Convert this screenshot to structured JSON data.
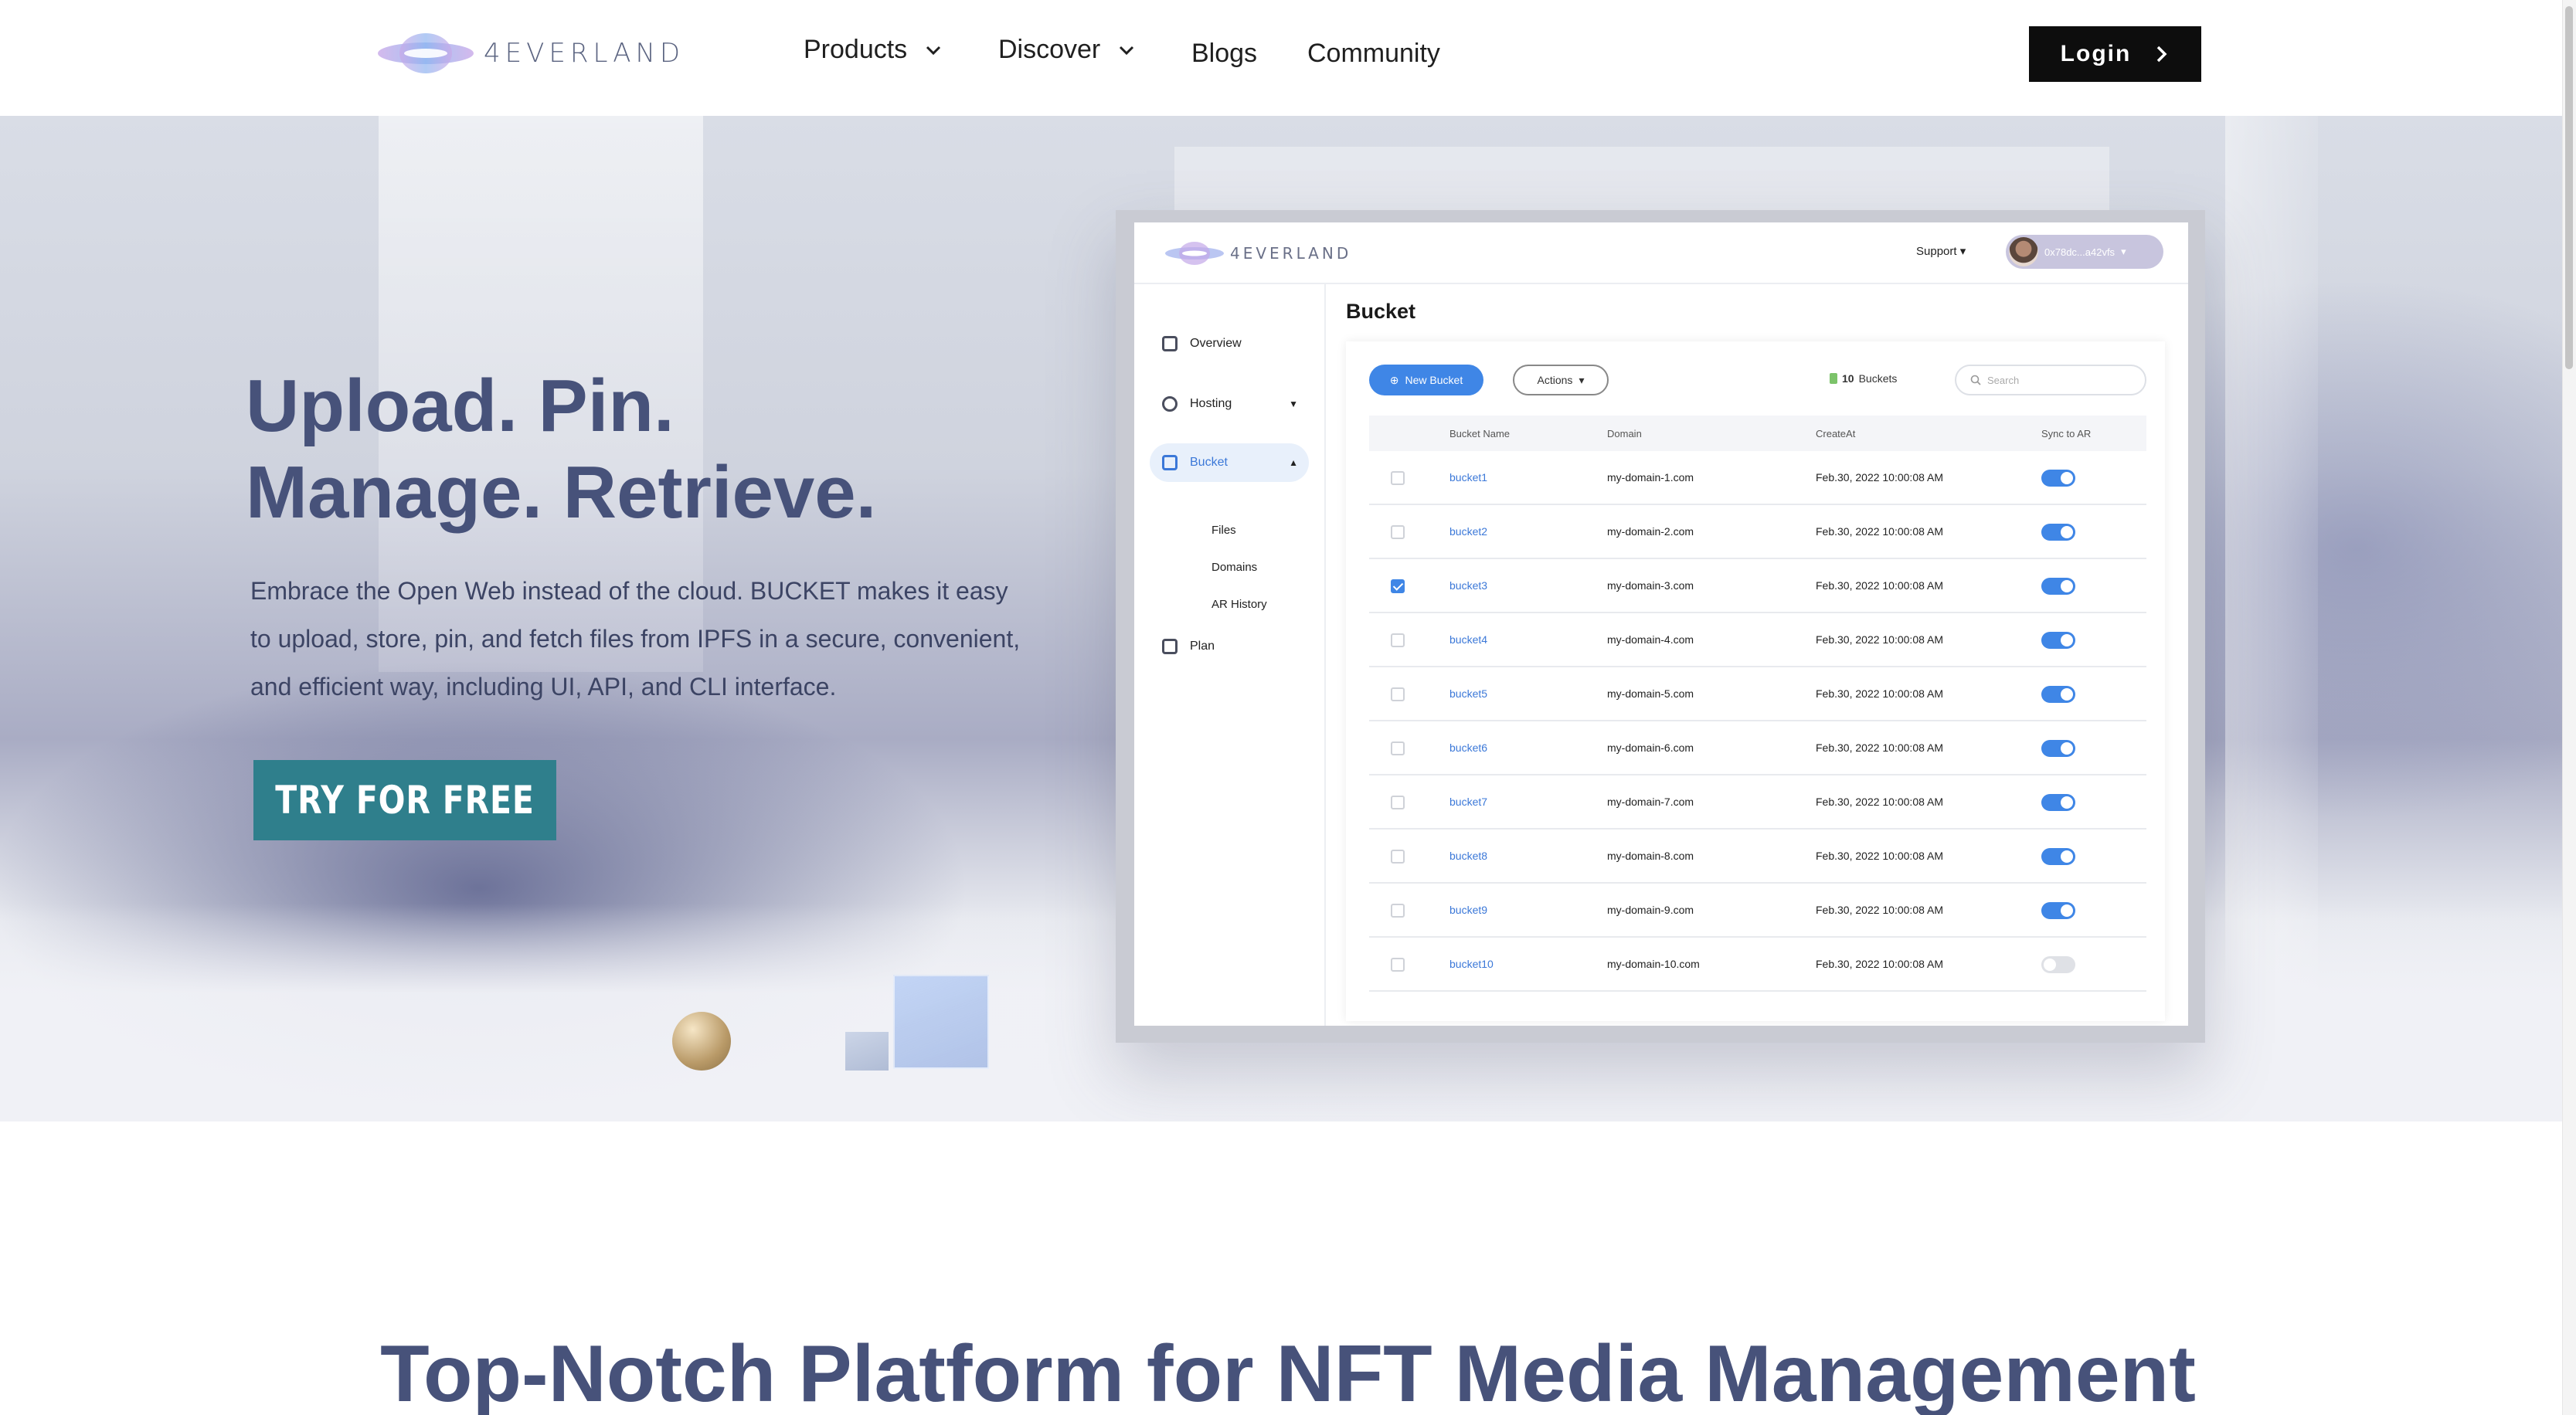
{
  "nav": {
    "logo_text": "4EVERLAND",
    "items": [
      {
        "label": "Products",
        "has_dropdown": true
      },
      {
        "label": "Discover",
        "has_dropdown": true
      },
      {
        "label": "Blogs",
        "has_dropdown": false
      },
      {
        "label": "Community",
        "has_dropdown": false
      }
    ],
    "login_label": "Login"
  },
  "hero": {
    "headline_line1": "Upload. Pin.",
    "headline_line2": "Manage. Retrieve.",
    "description": "Embrace the Open Web instead of the cloud. BUCKET makes it easy to upload, store, pin, and fetch files from IPFS in a secure, convenient, and efficient way, including UI, API, and CLI interface.",
    "cta_label": "TRY FOR FREE"
  },
  "dashboard": {
    "logo_text": "4EVERLAND",
    "support_label": "Support",
    "user_label": "0x78dc...a42vfs",
    "sidebar": {
      "items": [
        {
          "label": "Overview",
          "icon": "monitor-icon"
        },
        {
          "label": "Hosting",
          "icon": "globe-icon"
        },
        {
          "label": "Bucket",
          "icon": "box-icon",
          "active": true
        },
        {
          "label": "Plan",
          "icon": "receipt-icon"
        }
      ],
      "sub_items": [
        "Files",
        "Domains",
        "AR History"
      ]
    },
    "page_title": "Bucket",
    "new_bucket_label": "New Bucket",
    "actions_label": "Actions",
    "bucket_count": "10",
    "bucket_count_suffix": "Buckets",
    "search_placeholder": "Search",
    "table": {
      "headers": [
        "Bucket Name",
        "Domain",
        "CreateAt",
        "Sync to AR"
      ],
      "rows": [
        {
          "name": "bucket1",
          "domain": "my-domain-1.com",
          "created": "Feb.30, 2022 10:00:08 AM",
          "checked": false,
          "sync": true
        },
        {
          "name": "bucket2",
          "domain": "my-domain-2.com",
          "created": "Feb.30, 2022 10:00:08 AM",
          "checked": false,
          "sync": true
        },
        {
          "name": "bucket3",
          "domain": "my-domain-3.com",
          "created": "Feb.30, 2022 10:00:08 AM",
          "checked": true,
          "sync": true
        },
        {
          "name": "bucket4",
          "domain": "my-domain-4.com",
          "created": "Feb.30, 2022 10:00:08 AM",
          "checked": false,
          "sync": true
        },
        {
          "name": "bucket5",
          "domain": "my-domain-5.com",
          "created": "Feb.30, 2022 10:00:08 AM",
          "checked": false,
          "sync": true
        },
        {
          "name": "bucket6",
          "domain": "my-domain-6.com",
          "created": "Feb.30, 2022 10:00:08 AM",
          "checked": false,
          "sync": true
        },
        {
          "name": "bucket7",
          "domain": "my-domain-7.com",
          "created": "Feb.30, 2022 10:00:08 AM",
          "checked": false,
          "sync": true
        },
        {
          "name": "bucket8",
          "domain": "my-domain-8.com",
          "created": "Feb.30, 2022 10:00:08 AM",
          "checked": false,
          "sync": true
        },
        {
          "name": "bucket9",
          "domain": "my-domain-9.com",
          "created": "Feb.30, 2022 10:00:08 AM",
          "checked": false,
          "sync": true
        },
        {
          "name": "bucket10",
          "domain": "my-domain-10.com",
          "created": "Feb.30, 2022 10:00:08 AM",
          "checked": false,
          "sync": false
        }
      ]
    }
  },
  "section": {
    "title": "Top-Notch Platform for NFT Media Management"
  },
  "colors": {
    "headline": "#47527a",
    "cta": "#2f7f8c",
    "accent_blue": "#3f86e6",
    "login_bg": "#0d0d0d"
  }
}
